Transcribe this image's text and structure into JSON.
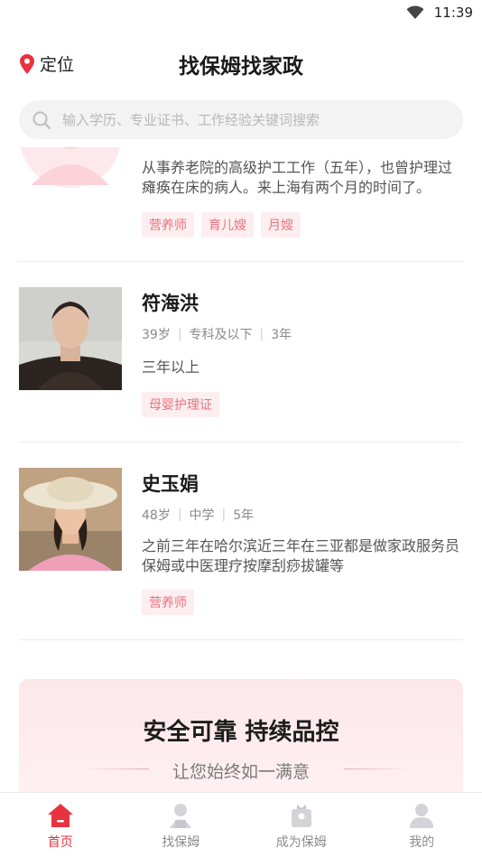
{
  "status_bar": {
    "time": "11:39"
  },
  "header": {
    "location_label": "定位",
    "title": "找保姆找家政"
  },
  "search": {
    "placeholder": "输入学历、专业证书、工作经验关键词搜索"
  },
  "workers": [
    {
      "name": "",
      "desc": "从事养老院的高级护工工作（五年），也曾护理过瘫痪在床的病人。来上海有两个月的时间了。",
      "tags": [
        "营养师",
        "育儿嫂",
        "月嫂"
      ]
    },
    {
      "name": "符海洪",
      "age": "39岁",
      "education": "专科及以下",
      "experience": "3年",
      "desc": "三年以上",
      "tags": [
        "母婴护理证"
      ]
    },
    {
      "name": "史玉娟",
      "age": "48岁",
      "education": "中学",
      "experience": "5年",
      "desc": "之前三年在哈尔滨近三年在三亚都是做家政服务员保姆或中医理疗按摩刮痧拔罐等",
      "tags": [
        "营养师"
      ]
    }
  ],
  "promo": {
    "title": "安全可靠 持续品控",
    "subtitle": "让您始终如一满意"
  },
  "tabs": [
    {
      "label": "首页",
      "icon": "home-icon",
      "active": true
    },
    {
      "label": "找保姆",
      "icon": "nanny-icon",
      "active": false
    },
    {
      "label": "成为保姆",
      "icon": "become-nanny-icon",
      "active": false
    },
    {
      "label": "我的",
      "icon": "profile-icon",
      "active": false
    }
  ],
  "colors": {
    "accent": "#e8323f",
    "tag_text": "#e8747f",
    "tag_bg": "#fdeef0",
    "promo_bg": "#fde7ea"
  }
}
